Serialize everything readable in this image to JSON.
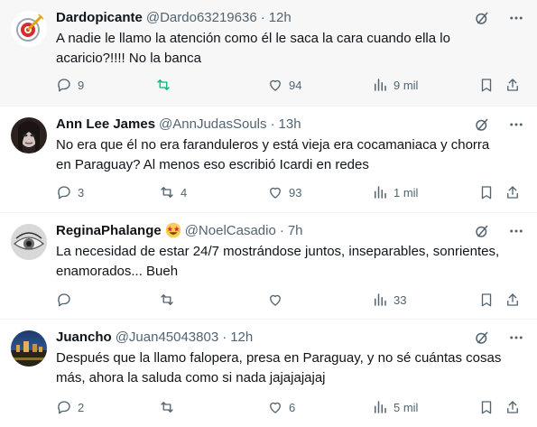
{
  "tweets": [
    {
      "name": "Dardopicante",
      "handle": "@Dardo63219636",
      "time": "12h",
      "text": "A nadie le llamo la atención como él le saca la cara cuando ella lo acaricio?!!!! No la banca",
      "replies": "9",
      "retweets": "",
      "likes": "94",
      "views": "9 mil",
      "retweet_active": true
    },
    {
      "name": "Ann Lee James",
      "handle": "@AnnJudasSouls",
      "time": "13h",
      "text": "No era que él no era faranduleros y está vieja era cocamaniaca y chorra en Paraguay? Al menos eso escribió Icardi en redes",
      "replies": "3",
      "retweets": "4",
      "likes": "93",
      "views": "1 mil",
      "retweet_active": false
    },
    {
      "name": "ReginaPhalange",
      "handle": "@NoelCasadio",
      "time": "7h",
      "text": "La necesidad de estar 24/7 mostrándose juntos, inseparables, sonrientes, enamorados... Bueh",
      "replies": "",
      "retweets": "",
      "likes": "",
      "views": "33",
      "retweet_active": false,
      "emoji": "star-struck-emoji"
    },
    {
      "name": "Juancho",
      "handle": "@Juan45043803",
      "time": "12h",
      "text": "Después que la llamo falopera, presa en Paraguay, y no sé cuántas cosas más, ahora la saluda como si nada jajajajajaj",
      "replies": "2",
      "retweets": "",
      "likes": "6",
      "views": "5 mil",
      "retweet_active": false
    }
  ],
  "icons": [
    "grok-icon",
    "more-icon",
    "reply-icon",
    "retweet-icon",
    "like-icon",
    "views-icon",
    "bookmark-icon",
    "share-icon"
  ],
  "colors": {
    "text": "#0f1419",
    "muted": "#536471",
    "retweet_active": "#00ba7c",
    "highlight_bg": "#f7f7f7"
  }
}
